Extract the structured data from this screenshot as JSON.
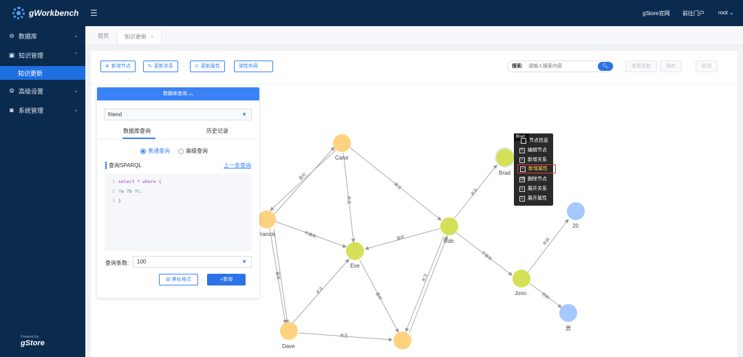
{
  "app": {
    "logo_text": "gWorkbench",
    "powered_by": "Powered by",
    "powered_brand": "gStore"
  },
  "sidebar": {
    "items": [
      {
        "label": "数据库",
        "icon": "database-icon"
      },
      {
        "label": "知识管理",
        "icon": "knowledge-icon"
      },
      {
        "label": "知识更新",
        "icon": ""
      },
      {
        "label": "高级设置",
        "icon": "settings-icon"
      },
      {
        "label": "系统管理",
        "icon": "system-icon"
      }
    ]
  },
  "topbar": {
    "links": [
      "gStore官网",
      "前往门户",
      "root"
    ]
  },
  "tabs": [
    "首页",
    "知识更新"
  ],
  "toolbar": {
    "buttons": [
      "新增节点",
      "更新关系",
      "更新属性",
      "弹性布局"
    ],
    "search_label": "搜索:",
    "search_placeholder": "请输入搜索内容",
    "right_buttons": [
      "查看更新",
      "保存",
      "取消"
    ]
  },
  "query_panel": {
    "title": "数据库查询",
    "database": "friend",
    "tabs": [
      "数据库查询",
      "历史记录"
    ],
    "modes": [
      "普通查询",
      "高级查询"
    ],
    "sparql_label": "查询SPARQL",
    "prev_link": "上一条查询",
    "code_lines": [
      {
        "num": "1",
        "keyword": "select * where {",
        "text": ""
      },
      {
        "num": "2",
        "keyword": "",
        "text": "?a ?b ?c."
      },
      {
        "num": "3",
        "keyword": "",
        "text": "}"
      }
    ],
    "limit_label": "查询条数:",
    "limit_value": "100",
    "beautify_label": "美化格式",
    "query_label": "查询"
  },
  "graph": {
    "nodes": [
      {
        "id": "Carol",
        "label": "Carol",
        "color": "#ffd27f"
      },
      {
        "id": "Francis",
        "label": "Francis",
        "color": "#ffd27f"
      },
      {
        "id": "Eve",
        "label": "Eve",
        "color": "#d4e157"
      },
      {
        "id": "Bob",
        "label": "Bob",
        "color": "#d4e157"
      },
      {
        "id": "Brad",
        "label": "Brad",
        "color": "#d4e157"
      },
      {
        "id": "Jonn",
        "label": "Jonn",
        "color": "#d4e157"
      },
      {
        "id": "Dave",
        "label": "Dave",
        "color": "#ffd27f"
      },
      {
        "id": "Unknown",
        "label": "",
        "color": "#ffd27f"
      },
      {
        "id": "20",
        "label": "20",
        "color": "#a5c8ff"
      },
      {
        "id": "male",
        "label": "男",
        "color": "#a5c8ff"
      }
    ],
    "edge_labels": [
      "喜欢",
      "关注",
      "关注",
      "不喜欢",
      "喜欢",
      "关注",
      "不喜欢",
      "喜欢",
      "关注",
      "年龄",
      "性别",
      "关注",
      "喜欢",
      "关注"
    ]
  },
  "context_menu": {
    "title": "Brad",
    "items": [
      "节点信息",
      "编辑节点",
      "新增关系",
      "新增属性",
      "删除节点",
      "展开关系",
      "展开属性"
    ]
  }
}
